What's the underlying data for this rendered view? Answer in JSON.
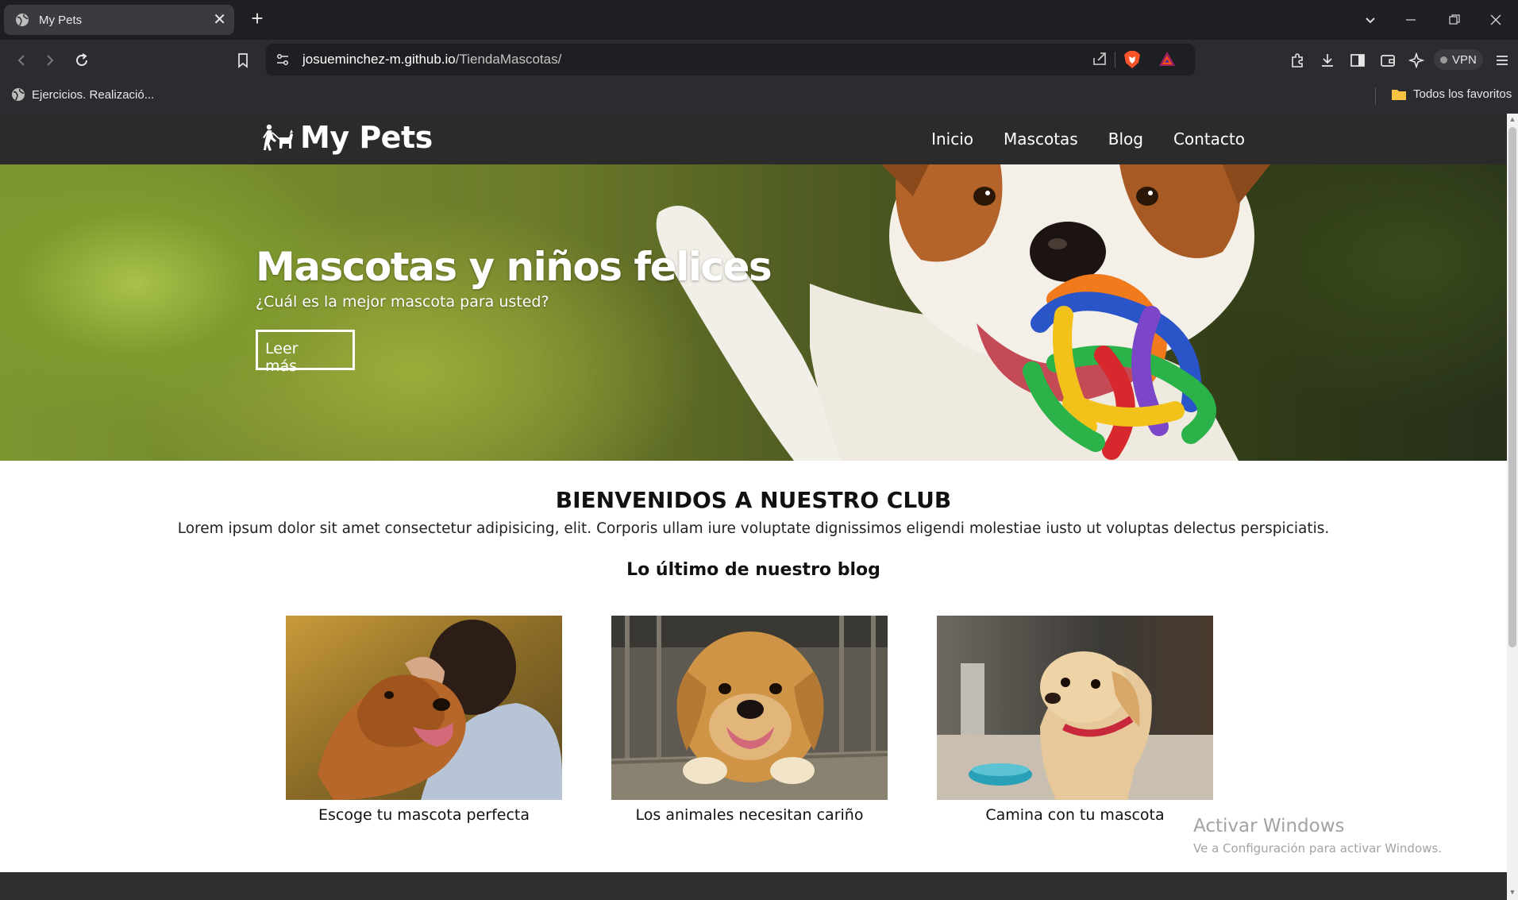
{
  "browser": {
    "tab_title": "My Pets",
    "url_host": "josueminchez-m.github.io",
    "url_path": "/TiendaMascotas/",
    "vpn_label": "VPN",
    "bookmark_item": "Ejercicios. Realizació...",
    "favorites_label": "Todos los favoritos"
  },
  "site": {
    "brand": "My Pets",
    "menu": [
      "Inicio",
      "Mascotas",
      "Blog",
      "Contacto"
    ]
  },
  "hero": {
    "title": "Mascotas y niños felices",
    "subtitle": "¿Cuál es la mejor mascota para usted?",
    "button": "Leer más"
  },
  "welcome": {
    "title": "BIENVENIDOS A NUESTRO CLUB",
    "text": "Lorem ipsum dolor sit amet consectetur adipisicing, elit. Corporis ullam iure voluptate dignissimos eligendi molestiae iusto ut voluptas delectus perspiciatis."
  },
  "blog": {
    "title": "Lo último de nuestro blog",
    "posts": [
      {
        "caption": "Escoge tu mascota perfecta"
      },
      {
        "caption": "Los animales necesitan cariño"
      },
      {
        "caption": "Camina con tu mascota"
      }
    ]
  },
  "watermark": {
    "line1": "Activar Windows",
    "line2": "Ve a Configuración para activar Windows."
  },
  "colors": {
    "header_bg": "#2b2b2b",
    "browser_bg": "#1e1f22",
    "toolbar_bg": "#2b2c30"
  }
}
